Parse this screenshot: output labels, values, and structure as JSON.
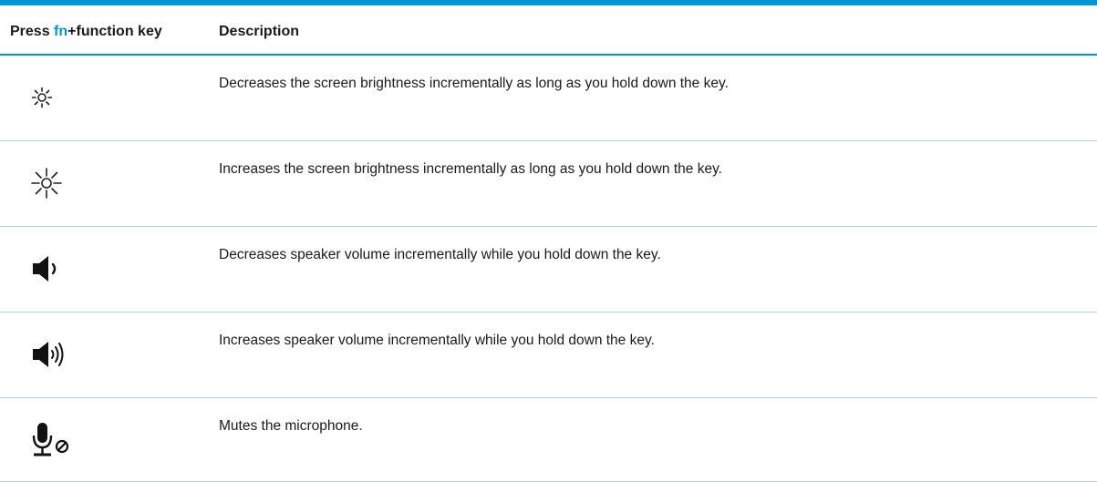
{
  "table": {
    "header": {
      "press_prefix": "Press ",
      "fn": "fn",
      "press_suffix": "+function key",
      "description": "Description"
    },
    "rows": [
      {
        "icon": "brightness-down-icon",
        "description": "Decreases the screen brightness incrementally as long as you hold down the key."
      },
      {
        "icon": "brightness-up-icon",
        "description": "Increases the screen brightness incrementally as long as you hold down the key."
      },
      {
        "icon": "volume-down-icon",
        "description": "Decreases speaker volume incrementally while you hold down the key."
      },
      {
        "icon": "volume-up-icon",
        "description": "Increases speaker volume incrementally while you hold down the key."
      },
      {
        "icon": "mic-mute-icon",
        "description": "Mutes the microphone."
      }
    ]
  },
  "colors": {
    "accent": "#0096d6",
    "row_divider": "#a9d2ea",
    "text": "#1a1a1a"
  }
}
